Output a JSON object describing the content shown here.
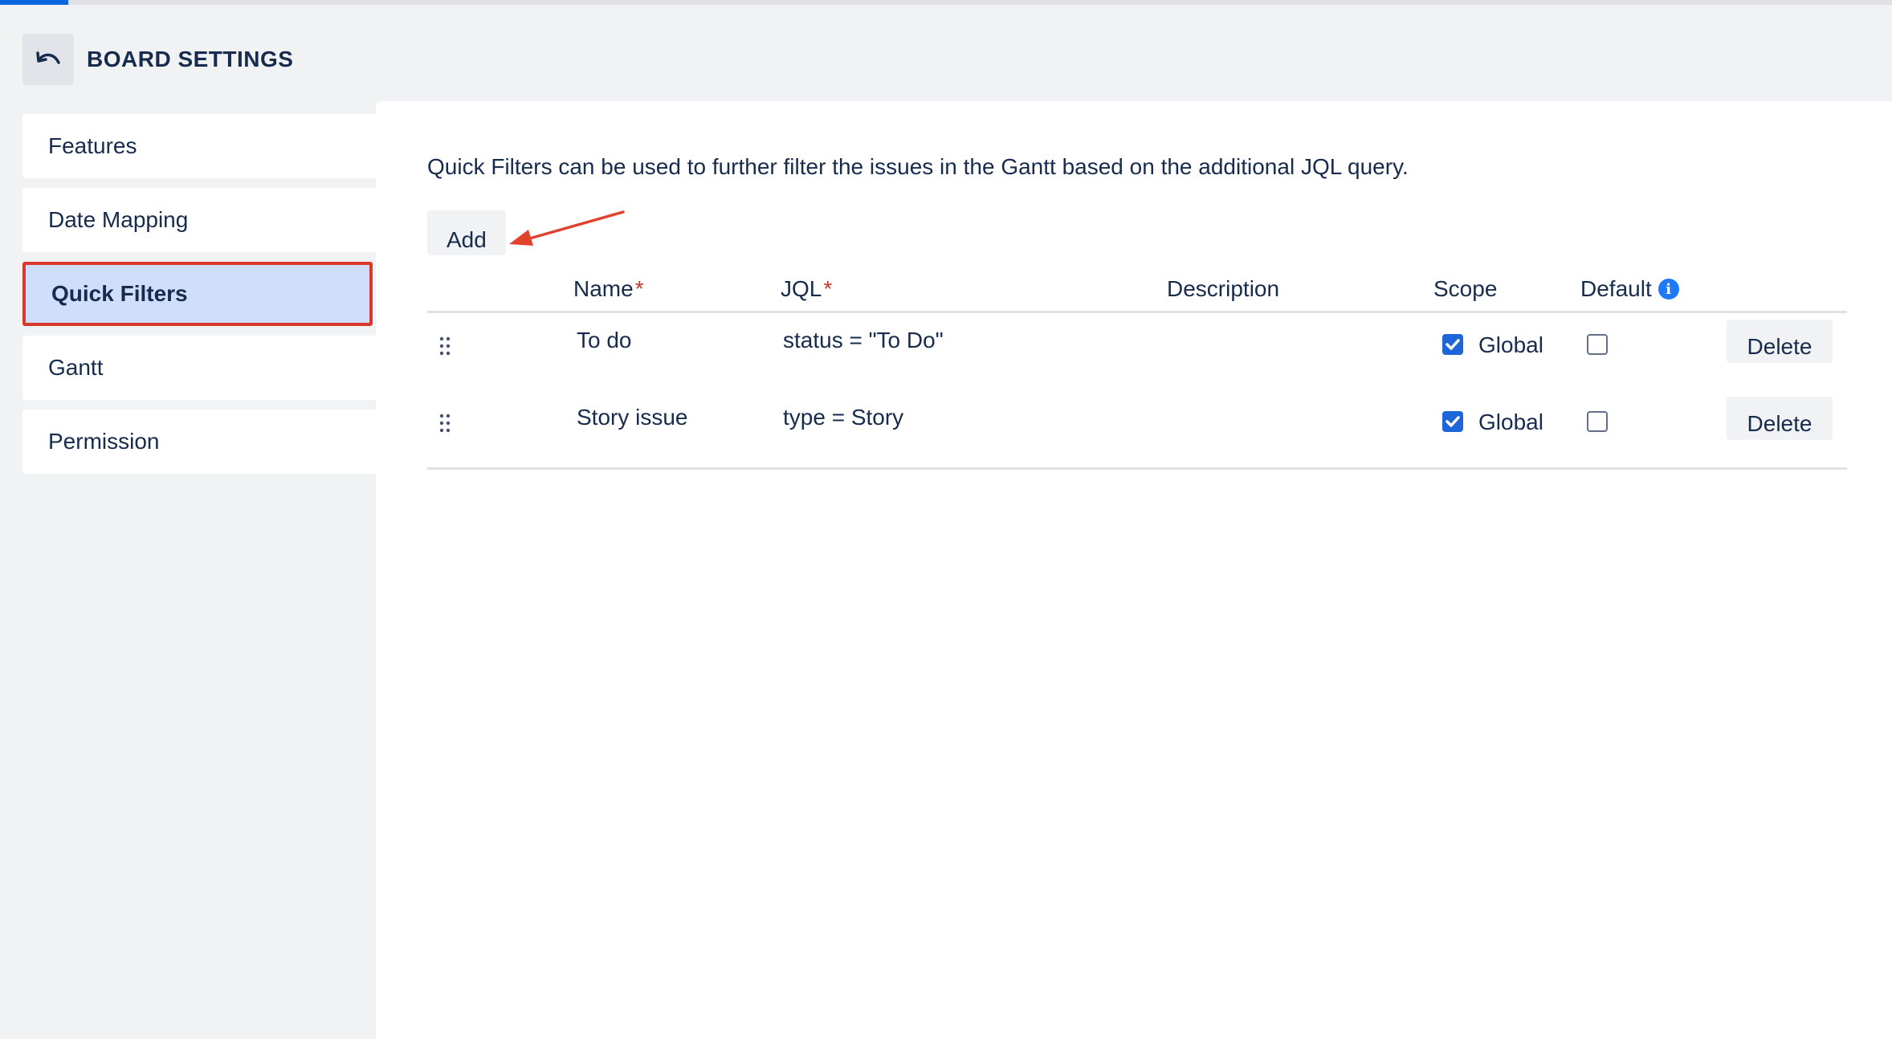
{
  "loading": {
    "progress": 0.036
  },
  "header": {
    "title": "BOARD SETTINGS",
    "back_icon": "undo-icon"
  },
  "sidebar": {
    "items": [
      {
        "label": "Features"
      },
      {
        "label": "Date Mapping"
      },
      {
        "label": "Quick Filters",
        "active": true
      },
      {
        "label": "Gantt"
      },
      {
        "label": "Permission"
      }
    ]
  },
  "main": {
    "intro": "Quick Filters can be used to further filter the issues in the Gantt based on the additional JQL query.",
    "add_label": "Add",
    "annotation_color": "#e2412e",
    "table": {
      "headers": {
        "name": "Name",
        "jql": "JQL",
        "description": "Description",
        "scope": "Scope",
        "default": "Default"
      },
      "required_marker": "*",
      "rows": [
        {
          "name": "To do",
          "jql": "status = \"To Do\"",
          "description": "",
          "scope_checked": true,
          "scope_label": "Global",
          "default_checked": false,
          "delete_label": "Delete"
        },
        {
          "name": "Story issue",
          "jql": "type = Story",
          "description": "",
          "scope_checked": true,
          "scope_label": "Global",
          "default_checked": false,
          "delete_label": "Delete"
        }
      ]
    }
  },
  "colors": {
    "accent": "#1d65d8",
    "active_bg": "#cfdffb",
    "highlight_border": "#d9392b"
  }
}
